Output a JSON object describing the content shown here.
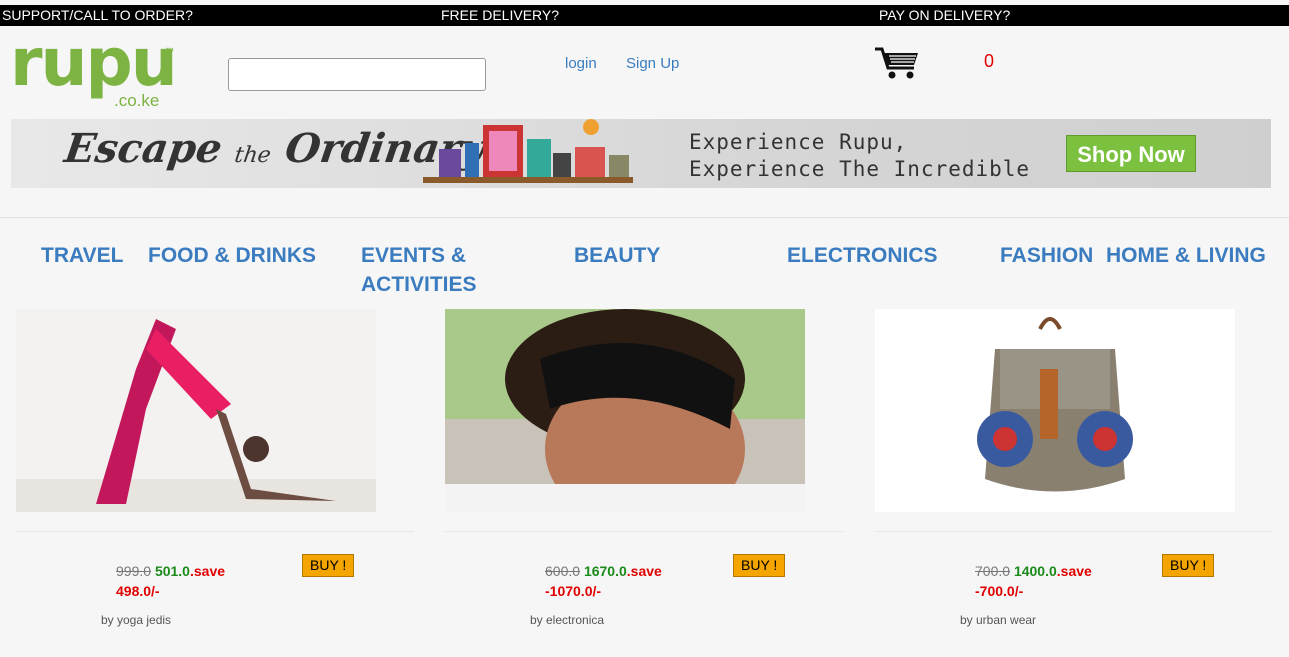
{
  "topbar": {
    "support": "SUPPORT/CALL TO ORDER?",
    "delivery": "FREE DELIVERY?",
    "pay": "PAY ON DELIVERY?"
  },
  "logo": {
    "word": "rupu",
    "tld": ".co.ke",
    "tm": "™"
  },
  "search": {
    "value": "",
    "placeholder": ""
  },
  "nav": {
    "login": "login",
    "signup": "Sign Up"
  },
  "cart": {
    "icon": "cart-icon",
    "count": "0"
  },
  "banner": {
    "escape": "Escape",
    "the": "the",
    "ordinary": "Ordinary",
    "line1": "Experience Rupu,",
    "line2": "Experience The Incredible",
    "cta": "Shop Now"
  },
  "categories": [
    "TRAVEL",
    "FOOD & DRINKS",
    "EVENTS & ACTIVITIES",
    "BEAUTY",
    "ELECTRONICS",
    "FASHION",
    "HOME & LIVING"
  ],
  "products": [
    {
      "old_price": "999.0",
      "new_price": "501.0",
      "save_label": ".save",
      "save_amount": "498.0/-",
      "buy": "BUY !",
      "vendor": "by yoga jedis"
    },
    {
      "old_price": "600.0",
      "new_price": "1670.0",
      "save_label": ".save",
      "save_amount": "-1070.0/-",
      "buy": "BUY !",
      "vendor": "by electronica"
    },
    {
      "old_price": "700.0",
      "new_price": "1400.0",
      "save_label": ".save",
      "save_amount": "-700.0/-",
      "buy": "BUY !",
      "vendor": "by urban wear"
    }
  ],
  "colors": {
    "brand_green": "#7cb342",
    "link_blue": "#3a7cbf",
    "save_red": "#e00000",
    "price_green": "#1a8a1a",
    "buy_orange": "#f4a500"
  }
}
